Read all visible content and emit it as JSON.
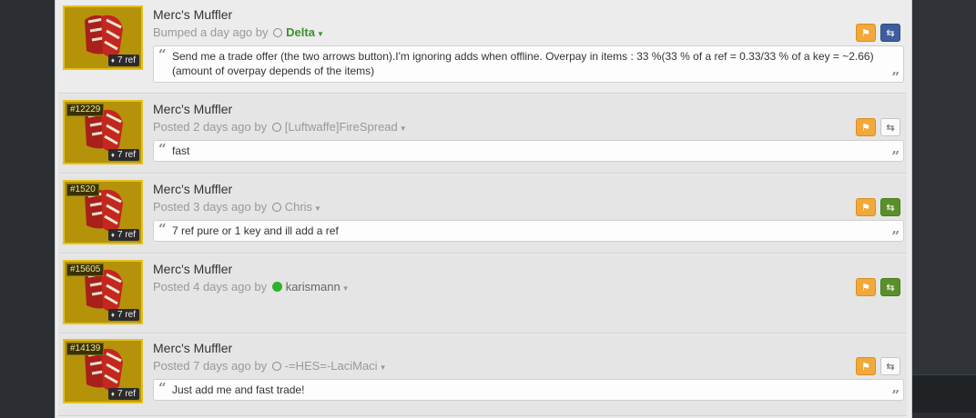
{
  "listings": [
    {
      "id": "",
      "item_name": "Merc's Muffler",
      "price": "7 ref",
      "status_verb": "Bumped",
      "time": "a day ago",
      "by": "by",
      "user": "Delta",
      "user_style": "green",
      "presence": "offline",
      "trade_button": "blue",
      "message": "Send me a trade offer (the two arrows button).I'm ignoring adds when offline. Overpay in items : 33 %(33 % of a ref = 0.33/33 % of a key = ~2.66)(amount of overpay depends of the items)"
    },
    {
      "id": "#12229",
      "item_name": "Merc's Muffler",
      "price": "7 ref",
      "status_verb": "Posted",
      "time": "2 days ago",
      "by": "by",
      "user": "[Luftwaffe]FireSpread",
      "user_style": "normal",
      "presence": "offline",
      "trade_button": "plain",
      "message": "fast"
    },
    {
      "id": "#1520",
      "item_name": "Merc's Muffler",
      "price": "7 ref",
      "status_verb": "Posted",
      "time": "3 days ago",
      "by": "by",
      "user": "Chris",
      "user_style": "normal",
      "presence": "offline",
      "trade_button": "green",
      "message": "7 ref pure or 1 key and ill add a ref"
    },
    {
      "id": "#15605",
      "item_name": "Merc's Muffler",
      "price": "7 ref",
      "status_verb": "Posted",
      "time": "4 days ago",
      "by": "by",
      "user": "karismann",
      "user_style": "dark",
      "presence": "online",
      "trade_button": "green",
      "message": ""
    },
    {
      "id": "#14139",
      "item_name": "Merc's Muffler",
      "price": "7 ref",
      "status_verb": "Posted",
      "time": "7 days ago",
      "by": "by",
      "user": "-=HES=-LaciMaci",
      "user_style": "normal",
      "presence": "offline",
      "trade_button": "plain",
      "message": "Just add me and fast trade!"
    }
  ],
  "icons": {
    "flag": "flag-icon",
    "trade": "two-arrows-exchange-icon",
    "price_tag": "tag-icon",
    "quote_open": "quote-open-icon",
    "quote_close": "quote-close-icon"
  },
  "colors": {
    "flag_button": "#f0a93a",
    "trade_blue": "#3d5d9e",
    "trade_green": "#5b8f2a",
    "item_border": "#e6c11a",
    "online_dot": "#2fb12b",
    "user_green": "#3e8e2f"
  }
}
